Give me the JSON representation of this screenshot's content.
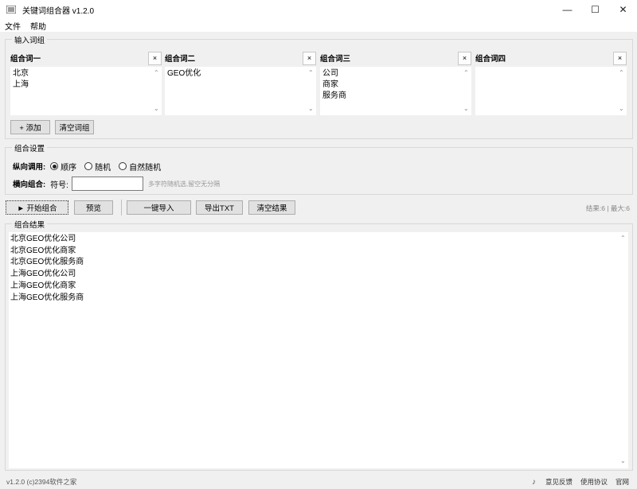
{
  "window": {
    "title": "关键词组合器 v1.2.0",
    "icon": "app-logo-icon",
    "minimize": "—",
    "maximize": "☐",
    "close": "✕"
  },
  "menu": {
    "file": "文件",
    "help": "帮助"
  },
  "input_group": {
    "title": "输入词组",
    "columns": [
      {
        "label": "组合词一",
        "close": "×",
        "lines": [
          "北京",
          "上海"
        ]
      },
      {
        "label": "组合词二",
        "close": "×",
        "lines": [
          "GEO优化"
        ]
      },
      {
        "label": "组合词三",
        "close": "×",
        "lines": [
          "公司",
          "商家",
          "服务商"
        ]
      },
      {
        "label": "组合词四",
        "close": "×",
        "lines": []
      }
    ],
    "add_button": "+ 添加",
    "clear_button": "清空词组"
  },
  "settings": {
    "title": "组合设置",
    "vertical_label": "纵向调用:",
    "radios": [
      {
        "label": "顺序",
        "checked": true
      },
      {
        "label": "随机",
        "checked": false
      },
      {
        "label": "自然随机",
        "checked": false
      }
    ],
    "horizontal_label": "横向组合:",
    "symbol_label": "符号:",
    "symbol_value": "",
    "symbol_hint": "多字符随机选,留空无分隔"
  },
  "toolbar": {
    "start": "► 开始组合",
    "preview": "预览",
    "import": "一键导入",
    "export": "导出TXT",
    "clear_results": "清空结果",
    "stats": "结果:6 | 最大:6"
  },
  "results": {
    "title": "组合结果",
    "lines": [
      "北京GEO优化公司",
      "北京GEO优化商家",
      "北京GEO优化服务商",
      "上海GEO优化公司",
      "上海GEO优化商家",
      "上海GEO优化服务商"
    ]
  },
  "statusbar": {
    "version": "v1.2.0 (c)2394软件之家",
    "feedback": "意见反馈",
    "terms": "使用协议",
    "website": "官网"
  }
}
